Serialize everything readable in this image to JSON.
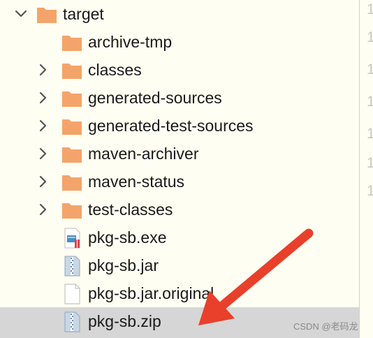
{
  "tree": {
    "root": {
      "label": "target",
      "expanded": true,
      "icon": "folder-icon"
    },
    "items": [
      {
        "label": "archive-tmp",
        "type": "folder",
        "expandable": false,
        "icon": "folder-icon"
      },
      {
        "label": "classes",
        "type": "folder",
        "expandable": true,
        "icon": "folder-icon"
      },
      {
        "label": "generated-sources",
        "type": "folder",
        "expandable": true,
        "icon": "folder-icon"
      },
      {
        "label": "generated-test-sources",
        "type": "folder",
        "expandable": true,
        "icon": "folder-icon"
      },
      {
        "label": "maven-archiver",
        "type": "folder",
        "expandable": true,
        "icon": "folder-icon"
      },
      {
        "label": "maven-status",
        "type": "folder",
        "expandable": true,
        "icon": "folder-icon"
      },
      {
        "label": "test-classes",
        "type": "folder",
        "expandable": true,
        "icon": "folder-icon"
      },
      {
        "label": "pkg-sb.exe",
        "type": "file",
        "expandable": false,
        "icon": "exe-file-icon"
      },
      {
        "label": "pkg-sb.jar",
        "type": "file",
        "expandable": false,
        "icon": "archive-file-icon"
      },
      {
        "label": "pkg-sb.jar.original",
        "type": "file",
        "expandable": false,
        "icon": "blank-file-icon"
      },
      {
        "label": "pkg-sb.zip",
        "type": "file",
        "expandable": false,
        "icon": "archive-file-icon",
        "selected": true
      }
    ]
  },
  "gutter": {
    "marks": [
      "1",
      "1",
      "1",
      "1",
      "1",
      "1",
      "1"
    ]
  },
  "watermark": "CSDN @老码龙",
  "colors": {
    "background": "#fffef2",
    "folder": "#f4a46a",
    "selected_row": "#d6d6d6",
    "arrow": "#e8402a",
    "text": "#1a1a1a"
  }
}
